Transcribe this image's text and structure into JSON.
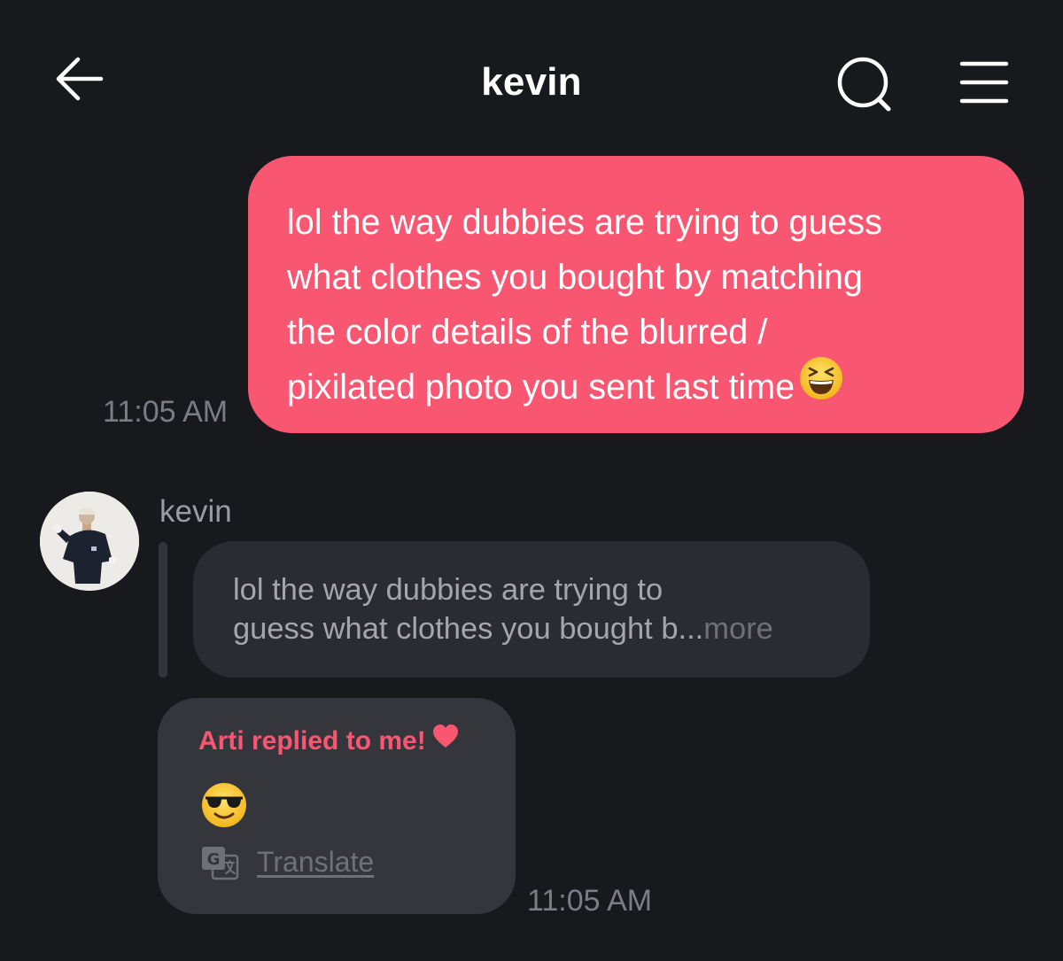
{
  "header": {
    "title": "kevin",
    "back_icon": "arrow-left-icon",
    "search_icon": "search-icon",
    "menu_icon": "hamburger-menu-icon"
  },
  "messages": {
    "sent": {
      "lines": [
        "lol the way dubbies are trying to guess",
        "what clothes you bought by matching",
        "the color details of the blurred /",
        "pixilated photo you sent last time"
      ],
      "emoji": "grinning-squinting-face-emoji",
      "time": "11:05 AM"
    },
    "received": {
      "sender": "kevin",
      "quoted_lines": [
        "lol the way dubbies are trying to",
        "guess what clothes you bought b..."
      ],
      "more_label": "more",
      "reply_heading": "Arti replied to me!",
      "heart_icon": "heart-icon",
      "reply_emoji": "smiling-face-with-sunglasses-emoji",
      "translate_label": "Translate",
      "translate_icon": "translate-icon",
      "time": "11:05 AM"
    }
  },
  "colors": {
    "background": "#18191d",
    "sent_bubble": "#f95671",
    "accent": "#f95671",
    "quoted_bubble": "#2a2c31",
    "reply_bubble": "#34363c",
    "timestamp": "#7b7d84"
  }
}
